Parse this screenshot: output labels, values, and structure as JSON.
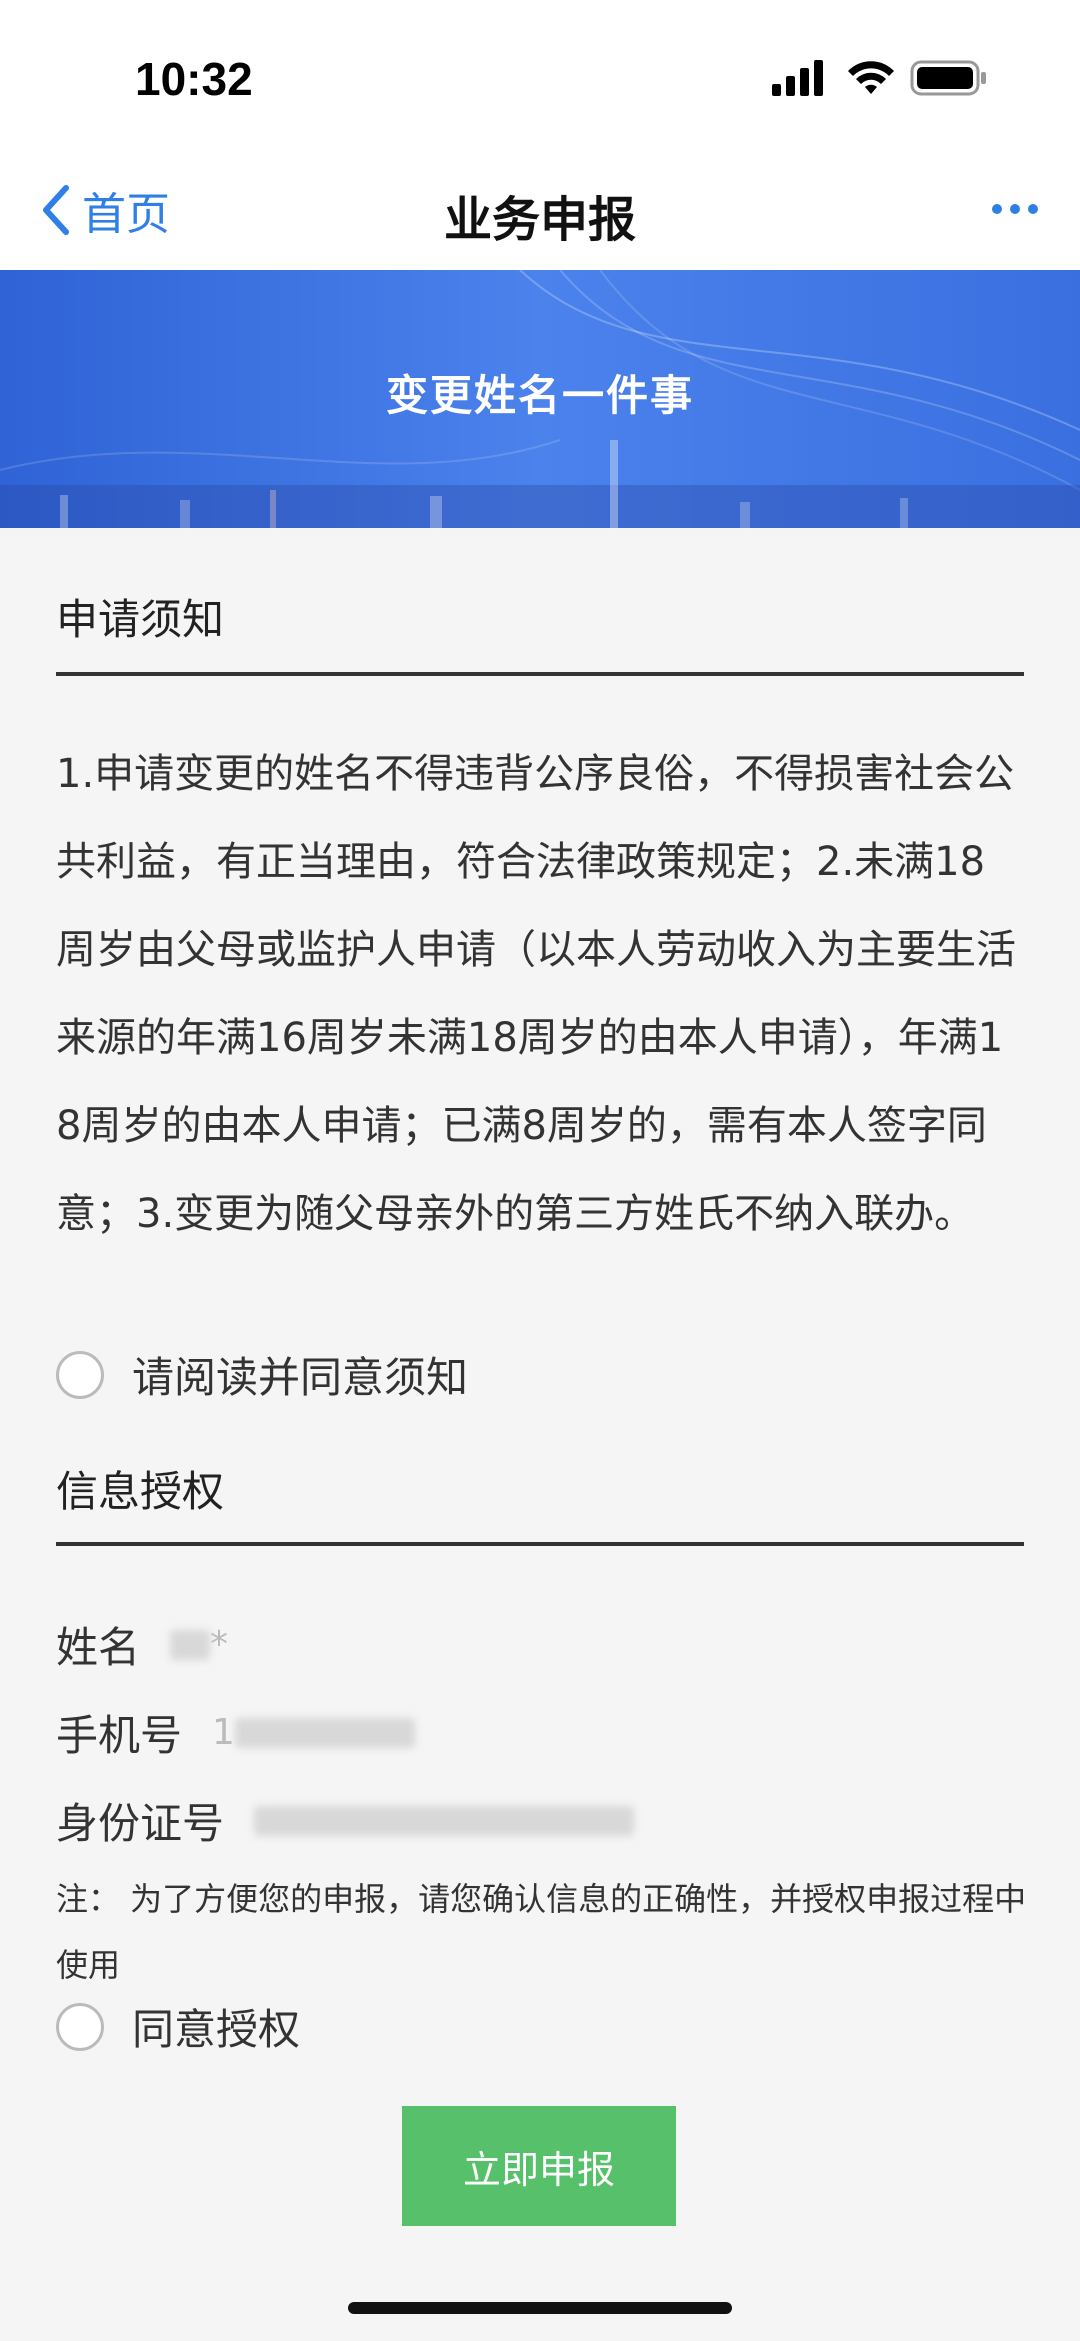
{
  "status_bar": {
    "time": "10:32",
    "icons": [
      "signal-icon",
      "wifi-icon",
      "battery-icon"
    ]
  },
  "nav": {
    "back_label": "首页",
    "title": "业务申报",
    "more_icon": "more-dots-icon",
    "accent_color": "#2f7fe6"
  },
  "banner": {
    "title": "变更姓名一件事",
    "color": "#3a6fe0"
  },
  "notice": {
    "header": "申请须知",
    "text": "1.申请变更的姓名不得违背公序良俗，不得损害社会公共利益，有正当理由，符合法律政策规定；2.未满18周岁由父母或监护人申请（以本人劳动收入为主要生活来源的年满16周岁未满18周岁的由本人申请），年满18周岁的由本人申请；已满8周岁的，需有本人签字同意；3.变更为随父母亲外的第三方姓氏不纳入联办。",
    "agree_label": "请阅读并同意须知",
    "agree_checked": false
  },
  "auth": {
    "header": "信息授权",
    "fields": [
      {
        "label": "姓名",
        "value": "*"
      },
      {
        "label": "手机号",
        "value": "1"
      },
      {
        "label": "身份证号",
        "value": ""
      }
    ],
    "note": "注：  为了方便您的申报，请您确认信息的正确性，并授权申报过程中使用",
    "agree_label": "同意授权",
    "agree_checked": false
  },
  "submit": {
    "label": "立即申报",
    "color": "#56c06a"
  }
}
